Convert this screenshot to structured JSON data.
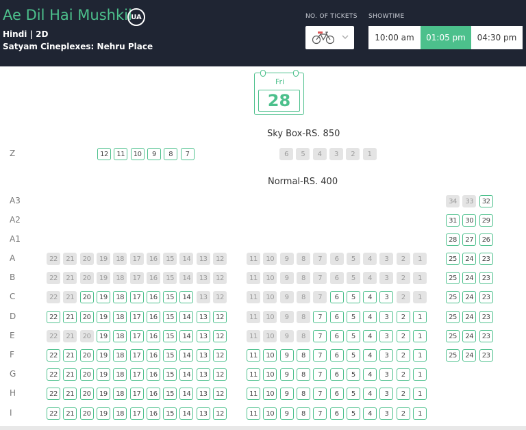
{
  "header": {
    "title": "Ae Dil Hai Mushkil",
    "rating_badge": "UA",
    "language_format": "Hindi | 2D",
    "venue": "Satyam Cineplexes: Nehru Place",
    "tickets_label": "NO. OF TICKETS",
    "tickets_icon": "bicycle-icon",
    "showtime_label": "SHOWTIME",
    "showtimes": [
      {
        "label": "10:00 am",
        "active": false
      },
      {
        "label": "01:05 pm",
        "active": true
      },
      {
        "label": "04:30 pm",
        "active": false
      }
    ]
  },
  "date": {
    "day": "Fri",
    "date": "28"
  },
  "colors": {
    "accent": "#4cc08c",
    "header_bg": "#1f2533",
    "sold_bg": "#e4e4e4"
  },
  "sections": [
    {
      "title": "Sky Box-RS. 850",
      "rows": [
        {
          "label": "Z",
          "blocks": [
            {
              "seats": [
                "12",
                "11",
                "10",
                "9",
                "8",
                "7"
              ],
              "available": [
                true,
                true,
                true,
                true,
                true,
                true
              ]
            },
            {
              "seats": [
                "6",
                "5",
                "4",
                "3",
                "2",
                "1"
              ],
              "available": [
                false,
                false,
                false,
                false,
                false,
                false
              ]
            }
          ]
        }
      ]
    },
    {
      "title": "Normal-RS. 400",
      "rows": [
        {
          "label": "A3",
          "blocks": [
            {
              "seats": [
                "34",
                "33",
                "32"
              ],
              "available": [
                false,
                false,
                true
              ]
            }
          ]
        },
        {
          "label": "A2",
          "blocks": [
            {
              "seats": [
                "31",
                "30",
                "29"
              ],
              "available": [
                true,
                true,
                true
              ]
            }
          ]
        },
        {
          "label": "A1",
          "blocks": [
            {
              "seats": [
                "28",
                "27",
                "26"
              ],
              "available": [
                true,
                true,
                true
              ]
            }
          ]
        },
        {
          "label": "A",
          "blocks": [
            {
              "seats": [
                "22",
                "21",
                "20",
                "19",
                "18",
                "17",
                "16",
                "15",
                "14",
                "13",
                "12"
              ],
              "available": [
                false,
                false,
                false,
                false,
                false,
                false,
                false,
                false,
                false,
                false,
                false
              ]
            },
            {
              "seats": [
                "11",
                "10",
                "9",
                "8",
                "7",
                "6",
                "5",
                "4",
                "3",
                "2",
                "1"
              ],
              "available": [
                false,
                false,
                false,
                false,
                false,
                false,
                false,
                false,
                false,
                false,
                false
              ]
            },
            {
              "seats": [
                "25",
                "24",
                "23"
              ],
              "available": [
                true,
                true,
                true
              ]
            }
          ]
        },
        {
          "label": "B",
          "blocks": [
            {
              "seats": [
                "22",
                "21",
                "20",
                "19",
                "18",
                "17",
                "16",
                "15",
                "14",
                "13",
                "12"
              ],
              "available": [
                false,
                false,
                false,
                false,
                false,
                false,
                false,
                false,
                false,
                false,
                false
              ]
            },
            {
              "seats": [
                "11",
                "10",
                "9",
                "8",
                "7",
                "6",
                "5",
                "4",
                "3",
                "2",
                "1"
              ],
              "available": [
                false,
                false,
                false,
                false,
                false,
                false,
                false,
                false,
                false,
                false,
                false
              ]
            },
            {
              "seats": [
                "25",
                "24",
                "23"
              ],
              "available": [
                true,
                true,
                true
              ]
            }
          ]
        },
        {
          "label": "C",
          "blocks": [
            {
              "seats": [
                "22",
                "21",
                "20",
                "19",
                "18",
                "17",
                "16",
                "15",
                "14",
                "13",
                "12"
              ],
              "available": [
                false,
                false,
                true,
                true,
                true,
                true,
                true,
                true,
                true,
                false,
                false
              ]
            },
            {
              "seats": [
                "11",
                "10",
                "9",
                "8",
                "7",
                "6",
                "5",
                "4",
                "3",
                "2",
                "1"
              ],
              "available": [
                false,
                false,
                false,
                false,
                false,
                true,
                true,
                true,
                true,
                false,
                false
              ]
            },
            {
              "seats": [
                "25",
                "24",
                "23"
              ],
              "available": [
                true,
                true,
                true
              ]
            }
          ]
        },
        {
          "label": "D",
          "blocks": [
            {
              "seats": [
                "22",
                "21",
                "20",
                "19",
                "18",
                "17",
                "16",
                "15",
                "14",
                "13",
                "12"
              ],
              "available": [
                true,
                true,
                true,
                true,
                true,
                true,
                true,
                true,
                true,
                true,
                true
              ]
            },
            {
              "seats": [
                "11",
                "10",
                "9",
                "8",
                "7",
                "6",
                "5",
                "4",
                "3",
                "2",
                "1"
              ],
              "available": [
                false,
                false,
                false,
                false,
                true,
                true,
                true,
                true,
                true,
                true,
                true
              ]
            },
            {
              "seats": [
                "25",
                "24",
                "23"
              ],
              "available": [
                true,
                true,
                true
              ]
            }
          ]
        },
        {
          "label": "E",
          "blocks": [
            {
              "seats": [
                "22",
                "21",
                "20",
                "19",
                "18",
                "17",
                "16",
                "15",
                "14",
                "13",
                "12"
              ],
              "available": [
                false,
                false,
                false,
                true,
                true,
                true,
                true,
                true,
                true,
                true,
                true
              ]
            },
            {
              "seats": [
                "11",
                "10",
                "9",
                "8",
                "7",
                "6",
                "5",
                "4",
                "3",
                "2",
                "1"
              ],
              "available": [
                false,
                false,
                false,
                false,
                true,
                true,
                true,
                true,
                true,
                true,
                true
              ]
            },
            {
              "seats": [
                "25",
                "24",
                "23"
              ],
              "available": [
                true,
                true,
                true
              ]
            }
          ]
        },
        {
          "label": "F",
          "blocks": [
            {
              "seats": [
                "22",
                "21",
                "20",
                "19",
                "18",
                "17",
                "16",
                "15",
                "14",
                "13",
                "12"
              ],
              "available": [
                true,
                true,
                true,
                true,
                true,
                true,
                true,
                true,
                true,
                true,
                true
              ]
            },
            {
              "seats": [
                "11",
                "10",
                "9",
                "8",
                "7",
                "6",
                "5",
                "4",
                "3",
                "2",
                "1"
              ],
              "available": [
                true,
                true,
                true,
                true,
                true,
                true,
                true,
                true,
                true,
                true,
                true
              ]
            },
            {
              "seats": [
                "25",
                "24",
                "23"
              ],
              "available": [
                true,
                true,
                true
              ]
            }
          ]
        },
        {
          "label": "G",
          "blocks": [
            {
              "seats": [
                "22",
                "21",
                "20",
                "19",
                "18",
                "17",
                "16",
                "15",
                "14",
                "13",
                "12"
              ],
              "available": [
                true,
                true,
                true,
                true,
                true,
                true,
                true,
                true,
                true,
                true,
                true
              ]
            },
            {
              "seats": [
                "11",
                "10",
                "9",
                "8",
                "7",
                "6",
                "5",
                "4",
                "3",
                "2",
                "1"
              ],
              "available": [
                true,
                true,
                true,
                true,
                true,
                true,
                true,
                true,
                true,
                true,
                true
              ]
            }
          ]
        },
        {
          "label": "H",
          "blocks": [
            {
              "seats": [
                "22",
                "21",
                "20",
                "19",
                "18",
                "17",
                "16",
                "15",
                "14",
                "13",
                "12"
              ],
              "available": [
                true,
                true,
                true,
                true,
                true,
                true,
                true,
                true,
                true,
                true,
                true
              ]
            },
            {
              "seats": [
                "11",
                "10",
                "9",
                "8",
                "7",
                "6",
                "5",
                "4",
                "3",
                "2",
                "1"
              ],
              "available": [
                true,
                true,
                true,
                true,
                true,
                true,
                true,
                true,
                true,
                true,
                true
              ]
            }
          ]
        },
        {
          "label": "I",
          "blocks": [
            {
              "seats": [
                "22",
                "21",
                "20",
                "19",
                "18",
                "17",
                "16",
                "15",
                "14",
                "13",
                "12"
              ],
              "available": [
                true,
                true,
                true,
                true,
                true,
                true,
                true,
                true,
                true,
                true,
                true
              ]
            },
            {
              "seats": [
                "11",
                "10",
                "9",
                "8",
                "7",
                "6",
                "5",
                "4",
                "3",
                "2",
                "1"
              ],
              "available": [
                true,
                true,
                true,
                true,
                true,
                true,
                true,
                true,
                true,
                true,
                true
              ]
            }
          ]
        }
      ]
    }
  ]
}
